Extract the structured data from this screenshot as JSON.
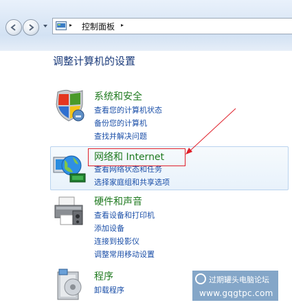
{
  "breadcrumb": {
    "location": "控制面板",
    "separator": "▸"
  },
  "page": {
    "title": "调整计算机的设置"
  },
  "categories": [
    {
      "title": "系统和安全",
      "links": [
        "查看您的计算机状态",
        "备份您的计算机",
        "查找并解决问题"
      ]
    },
    {
      "title": "网络和 Internet",
      "links": [
        "查看网络状态和任务",
        "选择家庭组和共享选项"
      ]
    },
    {
      "title": "硬件和声音",
      "links": [
        "查看设备和打印机",
        "添加设备",
        "连接到投影仪",
        "调整常用移动设置"
      ]
    },
    {
      "title": "程序",
      "links": [
        "卸载程序"
      ]
    }
  ],
  "watermark": {
    "name": "过期罐头电脑论坛",
    "url": "www.gqgtpc.com"
  },
  "colors": {
    "category_title": "#1f7a1f",
    "link": "#1b4fa8",
    "annotation": "#e0202a"
  }
}
